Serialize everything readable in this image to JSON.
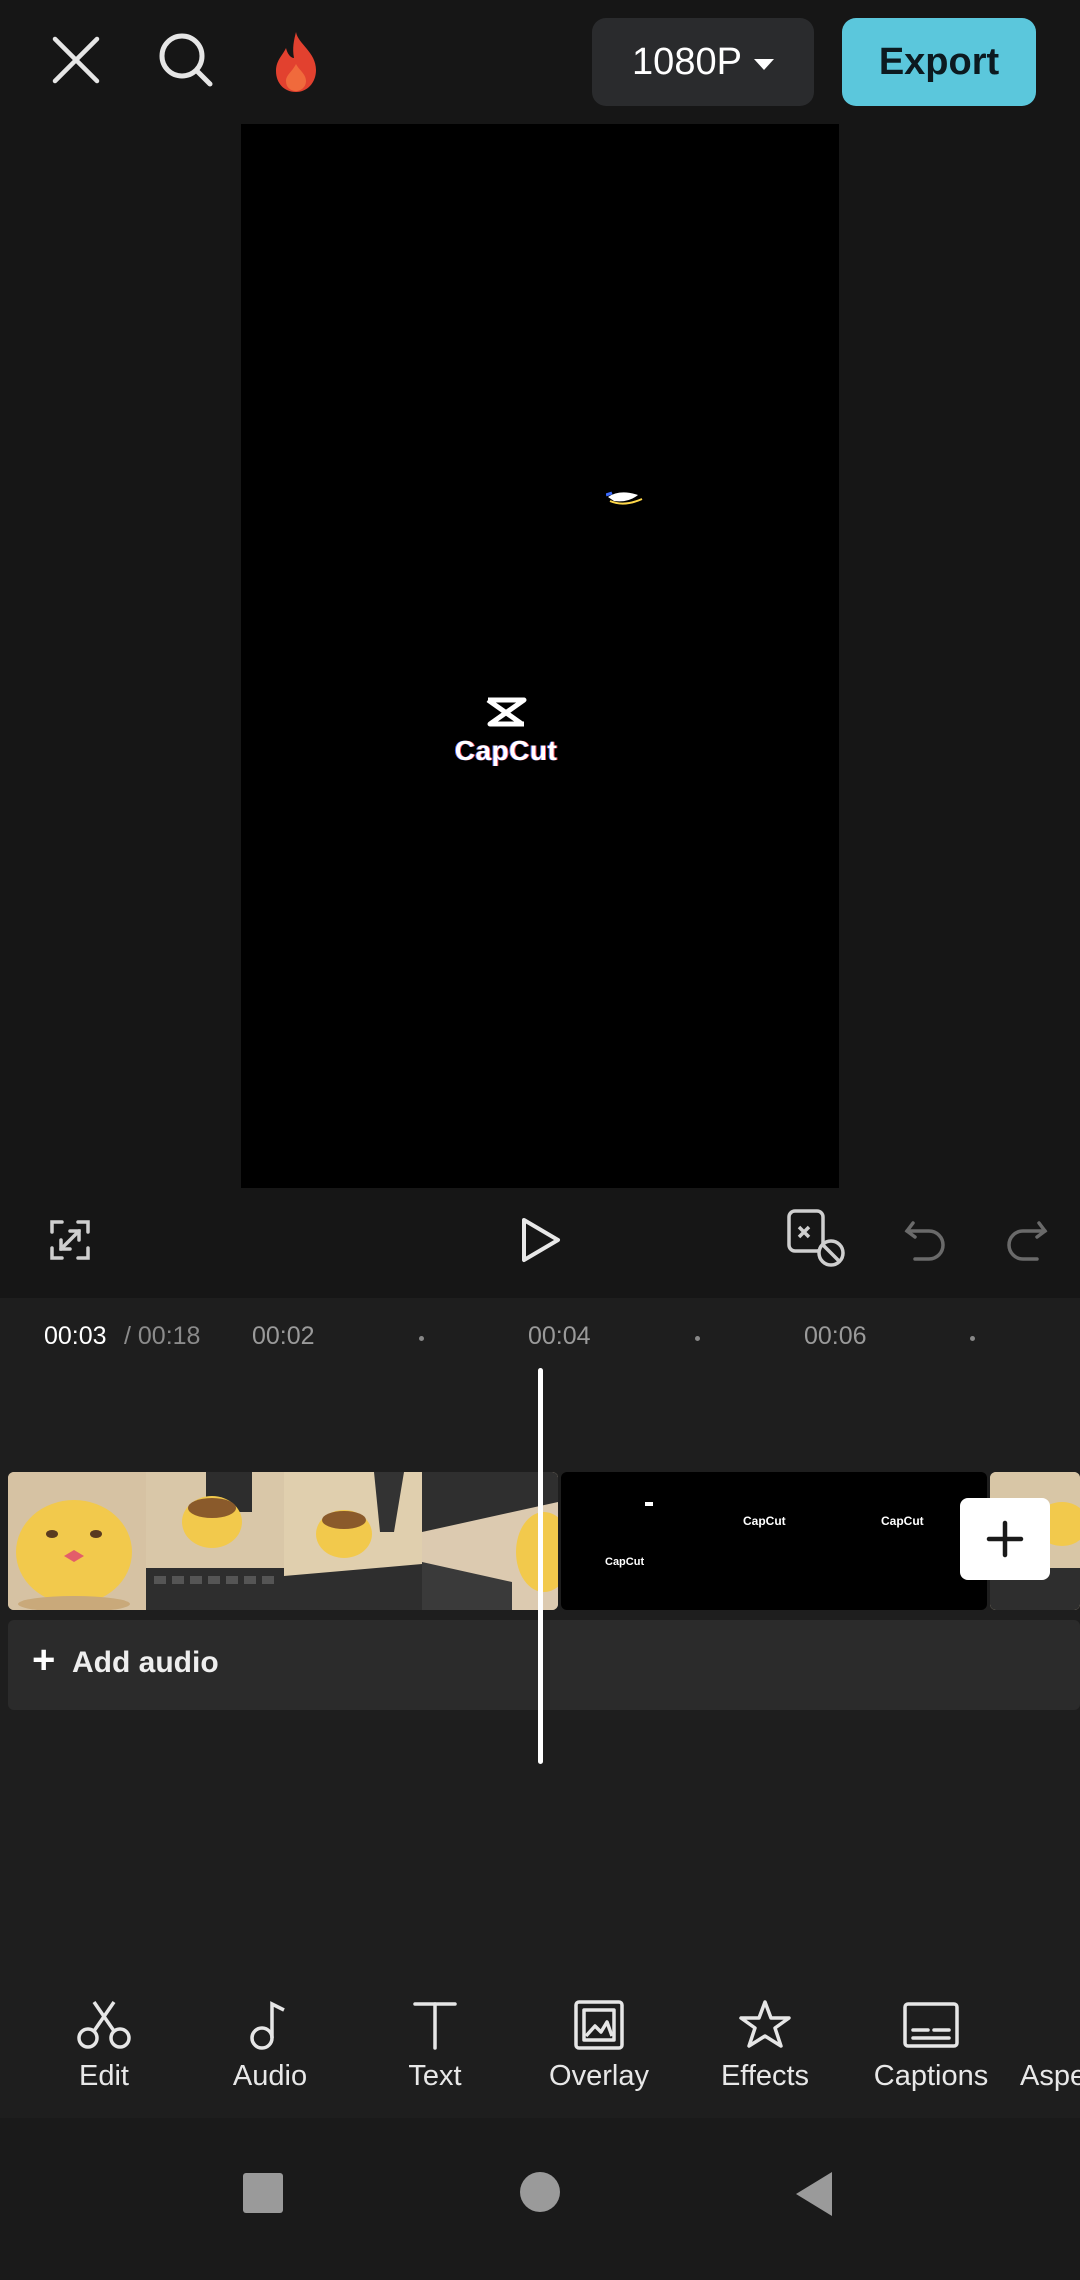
{
  "topbar": {
    "close_icon": "close-icon",
    "search_icon": "search-icon",
    "promo_icon": "flame-icon",
    "resolution_label": "1080P",
    "export_label": "Export"
  },
  "preview": {
    "watermark_text": "CapCut"
  },
  "controls": {
    "fullscreen_icon": "fullscreen-icon",
    "play_icon": "play-icon",
    "keyframe_icon": "keyframe-icon",
    "undo_icon": "undo-icon",
    "redo_icon": "redo-icon"
  },
  "timeline": {
    "current_time": "00:03",
    "total_time": "/ 00:18",
    "ticks": [
      "00:02",
      "00:04",
      "00:06"
    ],
    "clip_watermark": "CapCut",
    "add_audio_label": "Add audio"
  },
  "toolbar": {
    "items": [
      {
        "label": "Edit",
        "icon": "scissors-icon"
      },
      {
        "label": "Audio",
        "icon": "music-note-icon"
      },
      {
        "label": "Text",
        "icon": "text-icon"
      },
      {
        "label": "Overlay",
        "icon": "overlay-icon"
      },
      {
        "label": "Effects",
        "icon": "effects-star-icon"
      },
      {
        "label": "Captions",
        "icon": "captions-icon"
      },
      {
        "label": "Aspect",
        "icon": "aspect-icon"
      }
    ]
  },
  "colors": {
    "accent": "#5bc7dc",
    "background": "#161616",
    "panel": "#1e1e1e"
  }
}
